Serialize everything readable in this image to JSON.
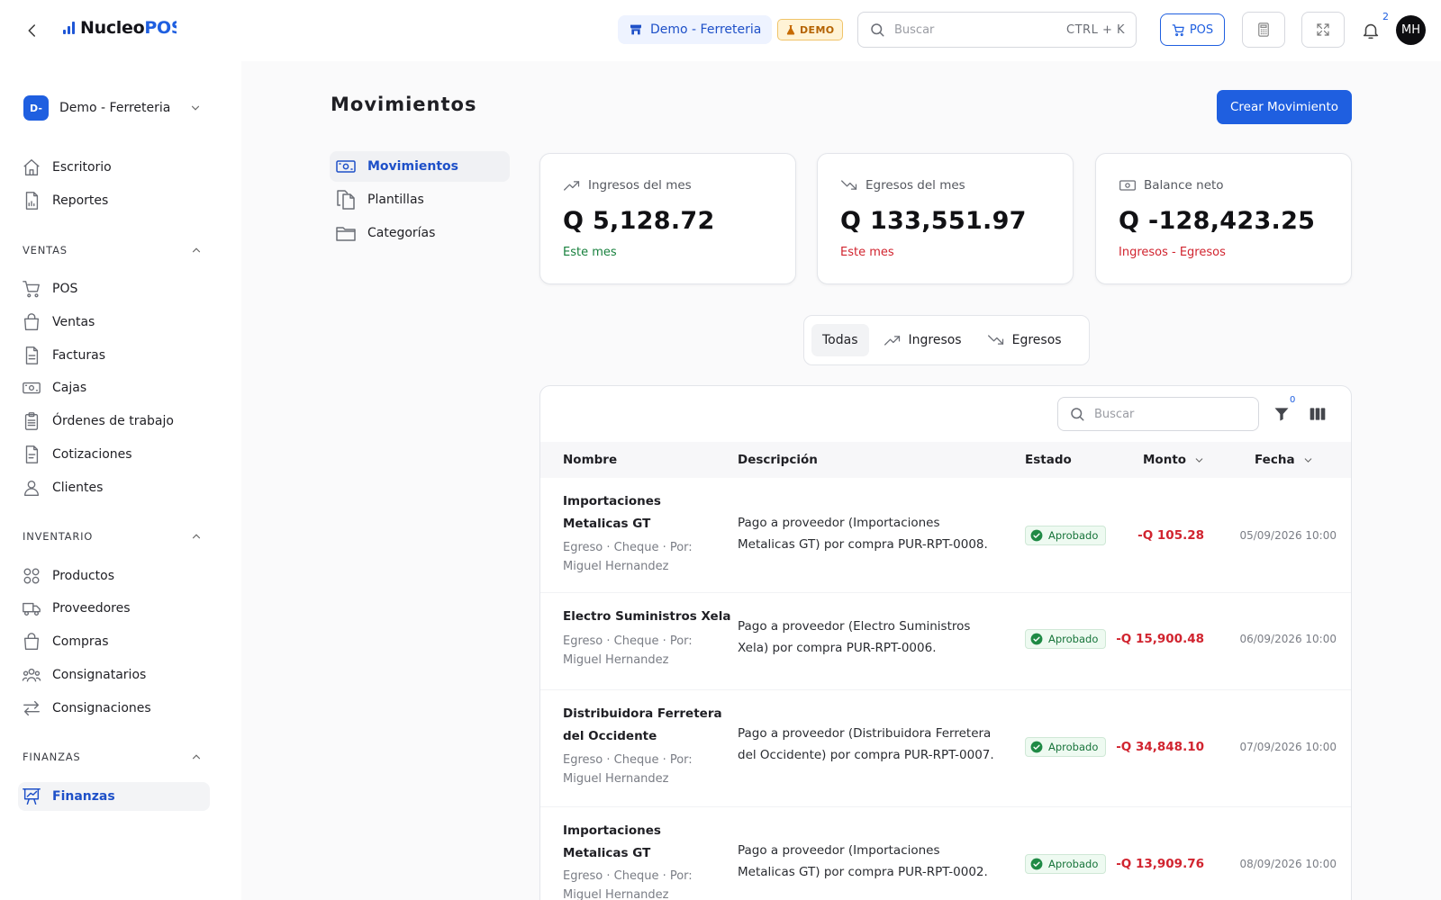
{
  "app": {
    "logo_a": "Nucleo",
    "logo_b": "POS",
    "store": "Demo - Ferreteria",
    "demo_badge": "DEMO",
    "search_placeholder": "Buscar",
    "search_shortcut": "CTRL + K",
    "pos_label": "POS",
    "notifications_count": "2",
    "user_initials": "MH",
    "accent": "#1f5fe0"
  },
  "sidebar": {
    "org_badge": "D-",
    "org_name": "Demo - Ferreteria",
    "top_items": [
      "Escritorio",
      "Reportes"
    ],
    "sections": [
      {
        "title": "VENTAS",
        "items": [
          "POS",
          "Ventas",
          "Facturas",
          "Cajas",
          "Órdenes de trabajo",
          "Cotizaciones",
          "Clientes"
        ]
      },
      {
        "title": "INVENTARIO",
        "items": [
          "Productos",
          "Proveedores",
          "Compras",
          "Consignatarios",
          "Consignaciones"
        ]
      },
      {
        "title": "FINANZAS",
        "items": [
          "Finanzas"
        ]
      }
    ]
  },
  "main": {
    "title": "Movimientos",
    "create_button": "Crear Movimiento",
    "subnav": [
      "Movimientos",
      "Plantillas",
      "Categorías"
    ],
    "stats": [
      {
        "label": "Ingresos del mes",
        "value": "Q 5,128.72",
        "sub": "Este mes",
        "sub_color": "#17803d"
      },
      {
        "label": "Egresos del mes",
        "value": "Q 133,551.97",
        "sub": "Este mes",
        "sub_color": "#d1242f"
      },
      {
        "label": "Balance neto",
        "value": "Q -128,423.25",
        "sub": "Ingresos - Egresos",
        "sub_color": "#d1242f"
      }
    ],
    "filters": [
      "Todas",
      "Ingresos",
      "Egresos"
    ],
    "table": {
      "search_placeholder": "Buscar",
      "filter_count": "0",
      "columns": [
        "Nombre",
        "Descripción",
        "Estado",
        "Monto",
        "Fecha"
      ],
      "rows": [
        {
          "name1": "Importaciones",
          "name2": "Metalicas GT",
          "meta1": "Egreso · Cheque · Por:",
          "meta2": "Miguel Hernandez",
          "desc1": "Pago a proveedor (Importaciones",
          "desc2": "Metalicas GT) por compra PUR-RPT-0008.",
          "status": "Aprobado",
          "amount": "-Q 105.28",
          "date": "05/09/2026 10:00"
        },
        {
          "name1": "Electro Suministros Xela",
          "name2": "",
          "meta1": "Egreso · Cheque · Por:",
          "meta2": "Miguel Hernandez",
          "desc1": "Pago a proveedor (Electro Suministros",
          "desc2": "Xela) por compra PUR-RPT-0006.",
          "status": "Aprobado",
          "amount": "-Q 15,900.48",
          "date": "06/09/2026 10:00"
        },
        {
          "name1": "Distribuidora Ferretera",
          "name2": "del Occidente",
          "meta1": "Egreso · Cheque · Por:",
          "meta2": "Miguel Hernandez",
          "desc1": "Pago a proveedor (Distribuidora Ferretera",
          "desc2": "del Occidente) por compra PUR-RPT-0007.",
          "status": "Aprobado",
          "amount": "-Q 34,848.10",
          "date": "07/09/2026 10:00"
        },
        {
          "name1": "Importaciones",
          "name2": "Metalicas GT",
          "meta1": "Egreso · Cheque · Por:",
          "meta2": "Miguel Hernandez",
          "desc1": "Pago a proveedor (Importaciones",
          "desc2": "Metalicas GT) por compra PUR-RPT-0002.",
          "status": "Aprobado",
          "amount": "-Q 13,909.76",
          "date": "08/09/2026 10:00"
        }
      ]
    }
  }
}
